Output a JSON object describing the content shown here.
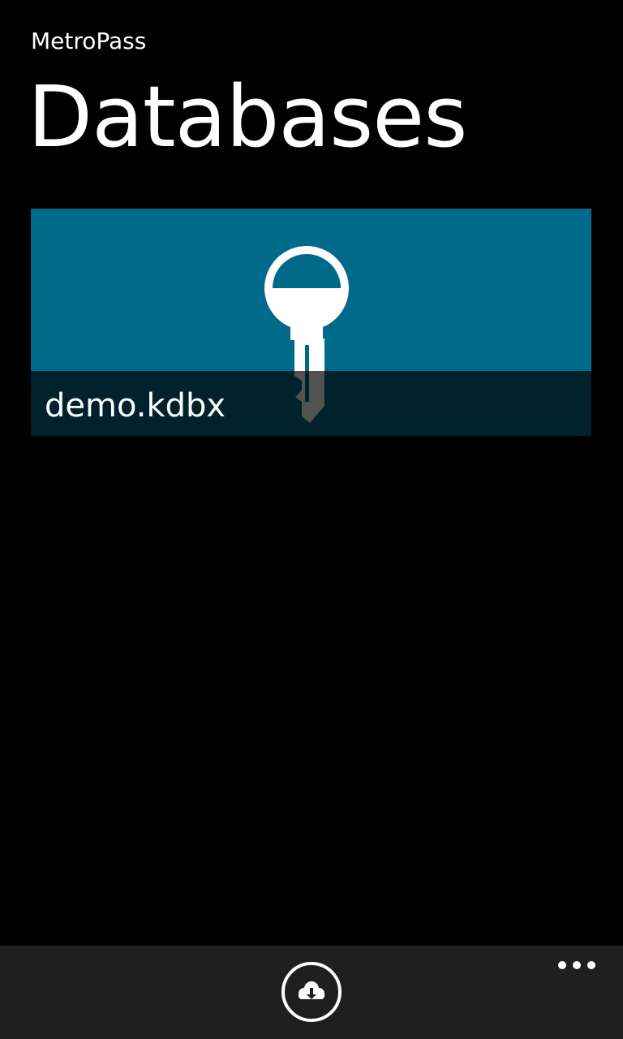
{
  "header": {
    "app_title": "MetroPass",
    "page_title": "Databases"
  },
  "databases": [
    {
      "name": "demo.kdbx",
      "icon": "key-icon"
    }
  ],
  "app_bar": {
    "primary_button_icon": "cloud-download-icon",
    "more_icon": "ellipsis-icon"
  },
  "colors": {
    "background": "#000000",
    "accent": "#006a8a",
    "app_bar": "#1f1f1f",
    "foreground": "#ffffff"
  }
}
